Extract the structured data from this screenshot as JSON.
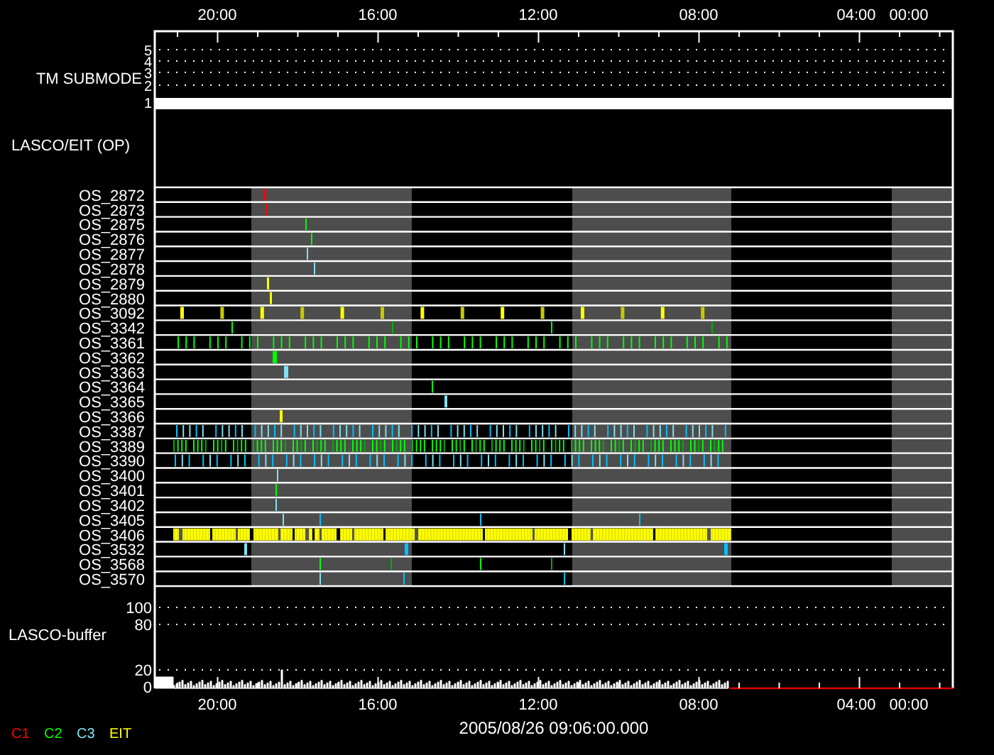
{
  "time_axis_top": {
    "labels": [
      "20:00",
      "16:00",
      "12:00",
      "08:00",
      "04:00",
      "00:00"
    ]
  },
  "tm_submode": {
    "label": "TM SUBMODE",
    "ticks": [
      "5",
      "4",
      "3",
      "2",
      "1"
    ]
  },
  "lasco_eit": {
    "label": "LASCO/EIT (OP)",
    "rows": [
      {
        "label": "OS_2872"
      },
      {
        "label": "OS_2873"
      },
      {
        "label": "OS_2875"
      },
      {
        "label": "OS_2876"
      },
      {
        "label": "OS_2877"
      },
      {
        "label": "OS_2878"
      },
      {
        "label": "OS_2879"
      },
      {
        "label": "OS_2880"
      },
      {
        "label": "OS_3092"
      },
      {
        "label": "OS_3342"
      },
      {
        "label": "OS_3361"
      },
      {
        "label": "OS_3362"
      },
      {
        "label": "OS_3363"
      },
      {
        "label": "OS_3364"
      },
      {
        "label": "OS_3365"
      },
      {
        "label": "OS_3366"
      },
      {
        "label": "OS_3387"
      },
      {
        "label": "OS_3389"
      },
      {
        "label": "OS_3390"
      },
      {
        "label": "OS_3400"
      },
      {
        "label": "OS_3401"
      },
      {
        "label": "OS_3402"
      },
      {
        "label": "OS_3405"
      },
      {
        "label": "OS_3406"
      },
      {
        "label": "OS_3532"
      },
      {
        "label": "OS_3568"
      },
      {
        "label": "OS_3570"
      }
    ]
  },
  "buffer": {
    "label": "LASCO-buffer",
    "ticks": [
      "100",
      "80",
      "20",
      "0"
    ]
  },
  "time_axis_bottom": {
    "labels": [
      "20:00",
      "16:00",
      "12:00",
      "08:00",
      "04:00",
      "00:00"
    ]
  },
  "date": "2005/08/26 09:06:00.000",
  "legend": [
    {
      "label": "C1",
      "color": "#ff0000"
    },
    {
      "label": "C2",
      "color": "#00ff00"
    },
    {
      "label": "C3",
      "color": "#80e0f0"
    },
    {
      "label": "EIT",
      "color": "#ffff00"
    }
  ]
}
